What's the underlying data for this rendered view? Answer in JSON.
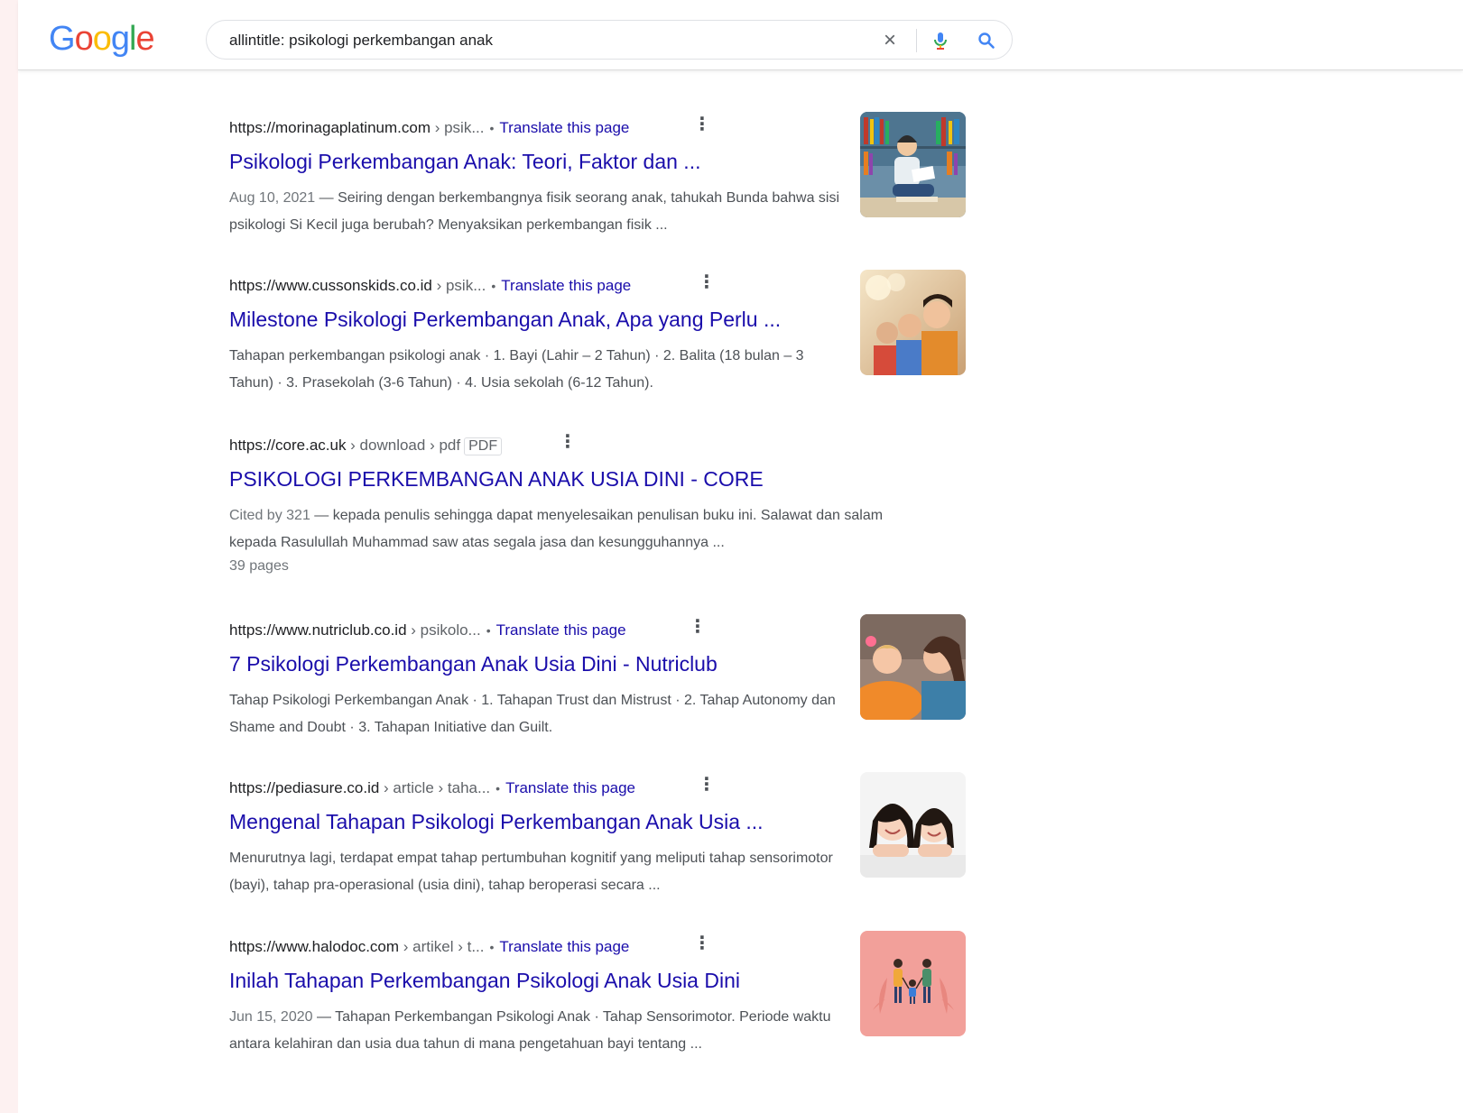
{
  "header": {
    "logo": [
      {
        "ch": "G",
        "color": "#4285F4"
      },
      {
        "ch": "o",
        "color": "#EA4335"
      },
      {
        "ch": "o",
        "color": "#FBBC05"
      },
      {
        "ch": "g",
        "color": "#4285F4"
      },
      {
        "ch": "l",
        "color": "#34A853"
      },
      {
        "ch": "e",
        "color": "#EA4335"
      }
    ],
    "search": {
      "query": "allintitle: psikologi perkembangan anak",
      "clear_icon": "close-icon",
      "mic_icon": "microphone-icon",
      "search_icon": "search-icon"
    }
  },
  "results": [
    {
      "domain": "https://morinagaplatinum.com",
      "path": " › psik...",
      "translate": "Translate this page",
      "title": "Psikologi Perkembangan Anak: Teori, Faktor dan ...",
      "date": "Aug 10, 2021",
      "snippet": "Seiring dengan berkembangnya fisik seorang anak, tahukah Bunda bahwa sisi psikologi Si Kecil juga berubah? Menyaksikan perkembangan fisik ...",
      "thumb": "child-reading-books-image"
    },
    {
      "domain": "https://www.cussonskids.co.id",
      "path": " › psik...",
      "translate": "Translate this page",
      "title": "Milestone Psikologi Perkembangan Anak, Apa yang Perlu ...",
      "date": "",
      "snippet": "Tahapan perkembangan psikologi anak · 1. Bayi (Lahir – 2 Tahun) · 2. Balita (18 bulan – 3 Tahun) · 3. Prasekolah (3-6 Tahun) · 4. Usia sekolah (6-12 Tahun).",
      "thumb": "children-looking-up-image"
    },
    {
      "domain": "https://core.ac.uk",
      "path": " › download › pdf",
      "badge": "PDF",
      "title": "PSIKOLOGI PERKEMBANGAN ANAK USIA DINI - CORE",
      "date": "Cited by 321",
      "snippet": "kepada penulis sehingga dapat menyelesaikan penulisan buku ini. Salawat dan salam kepada Rasulullah Muhammad saw atas segala jasa dan kesungguhannya ...",
      "extra": "39 pages"
    },
    {
      "domain": "https://www.nutriclub.co.id",
      "path": " › psikolo...",
      "translate": "Translate this page",
      "title": "7 Psikologi Perkembangan Anak Usia Dini - Nutriclub",
      "date": "",
      "snippet": "Tahap Psikologi Perkembangan Anak · 1. Tahapan Trust dan Mistrust · 2. Tahap Autonomy dan Shame and Doubt · 3. Tahapan Initiative dan Guilt.",
      "thumb": "mother-and-child-laughing-image"
    },
    {
      "domain": "https://pediasure.co.id",
      "path": " › article › taha...",
      "translate": "Translate this page",
      "title": "Mengenal Tahapan Psikologi Perkembangan Anak Usia ...",
      "date": "",
      "snippet": "Menurutnya lagi, terdapat empat tahap pertumbuhan kognitif yang meliputi tahap sensorimotor (bayi), tahap pra-operasional (usia dini), tahap beroperasi secara ...",
      "thumb": "two-smiling-girls-image"
    },
    {
      "domain": "https://www.halodoc.com",
      "path": " › artikel › t...",
      "translate": "Translate this page",
      "title": "Inilah Tahapan Perkembangan Psikologi Anak Usia Dini",
      "date": "Jun 15, 2020",
      "snippet": "Tahapan Perkembangan Psikologi Anak · Tahap Sensorimotor. Periode waktu antara kelahiran dan usia dua tahun di mana pengetahuan bayi tentang ...",
      "thumb": "family-illustration-image"
    }
  ]
}
